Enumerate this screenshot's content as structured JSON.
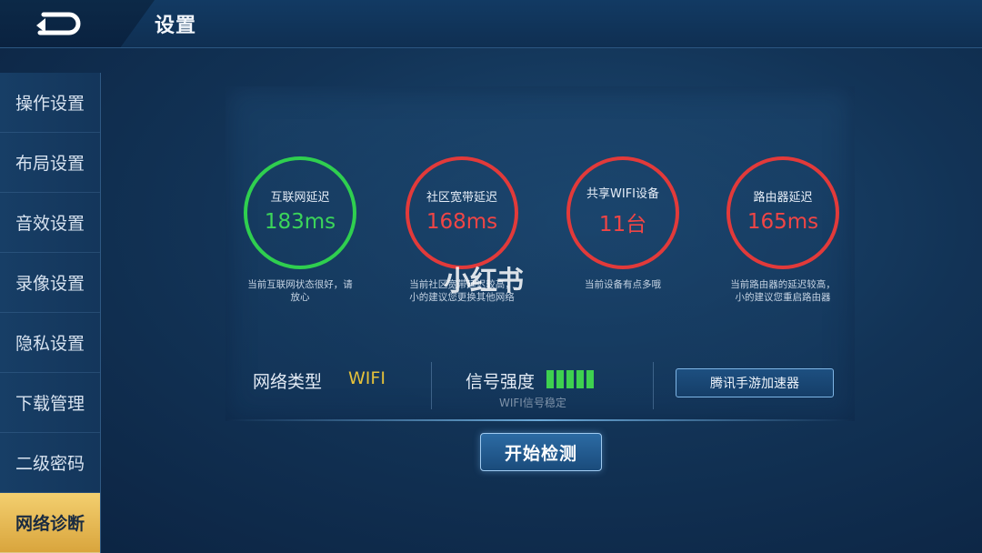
{
  "header": {
    "title": "设置",
    "back_icon": "back-arrow-icon"
  },
  "sidebar": {
    "items": [
      {
        "label": "操作设置",
        "active": false
      },
      {
        "label": "布局设置",
        "active": false
      },
      {
        "label": "音效设置",
        "active": false
      },
      {
        "label": "录像设置",
        "active": false
      },
      {
        "label": "隐私设置",
        "active": false
      },
      {
        "label": "下载管理",
        "active": false
      },
      {
        "label": "二级密码",
        "active": false
      },
      {
        "label": "网络诊断",
        "active": true
      }
    ]
  },
  "metrics": [
    {
      "label": "互联网延迟",
      "value": "183ms",
      "status": "green",
      "note_line1": "当前互联网状态很好，请",
      "note_line2": "放心"
    },
    {
      "label": "社区宽带延迟",
      "value": "168ms",
      "status": "red",
      "note_line1": "当前社区宽带延迟较高，",
      "note_line2": "小的建议您更换其他网络"
    },
    {
      "label": "共享WIFI设备",
      "value": "11台",
      "status": "red",
      "note_line1": "当前设备有点多哦",
      "note_line2": ""
    },
    {
      "label": "路由器延迟",
      "value": "165ms",
      "status": "red",
      "note_line1": "当前路由器的延迟较高，",
      "note_line2": "小的建议您重启路由器"
    }
  ],
  "watermark": "小红书",
  "network": {
    "type_label": "网络类型",
    "type_value": "WIFI",
    "signal_label": "信号强度",
    "signal_bars": 5,
    "signal_note": "WIFI信号稳定",
    "accelerator_button": "腾讯手游加速器"
  },
  "start_button": "开始检测",
  "colors": {
    "good": "#2fcf4f",
    "bad": "#e23a3a",
    "active_tab": "#e8bb55",
    "wifi_value": "#e6c23a"
  }
}
